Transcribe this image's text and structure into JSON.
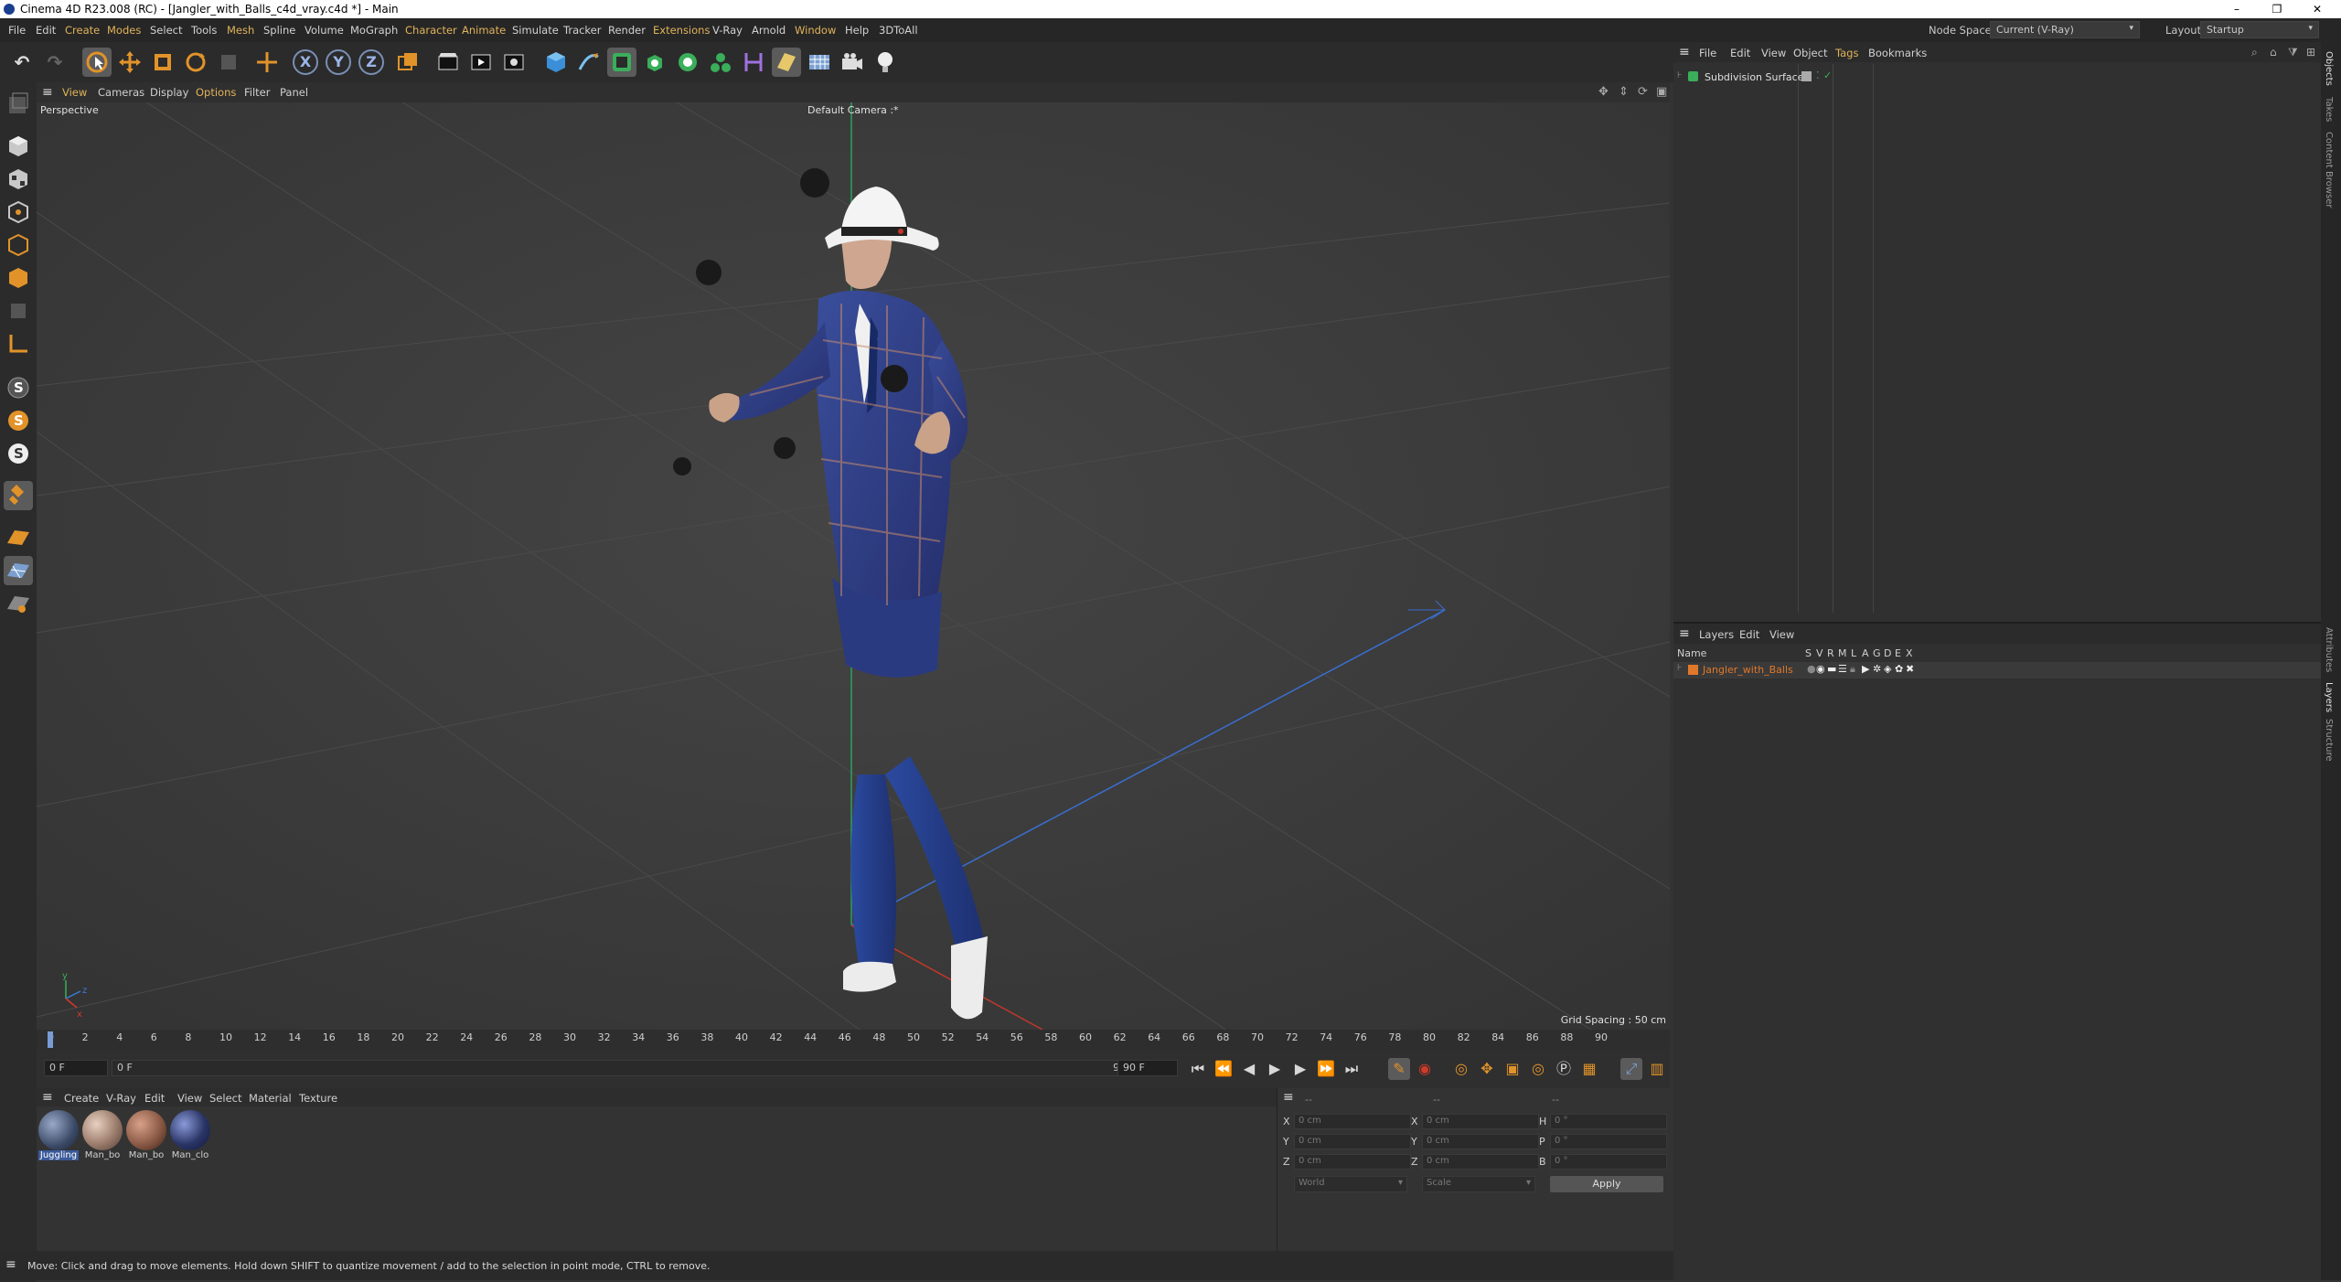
{
  "window": {
    "title": "Cinema 4D R23.008 (RC) - [Jangler_with_Balls_c4d_vray.c4d *] - Main",
    "minimize": "–",
    "restore": "❐",
    "close": "✕"
  },
  "menubar": {
    "items": [
      "File",
      "Edit",
      "Create",
      "Modes",
      "Select",
      "Tools",
      "Mesh",
      "Spline",
      "Volume",
      "MoGraph",
      "Character",
      "Animate",
      "Simulate",
      "Tracker",
      "Render",
      "Extensions",
      "V-Ray",
      "Arnold",
      "Window",
      "Help",
      "3DToAll"
    ],
    "node_space_label": "Node Space:",
    "node_space_value": "Current (V-Ray)",
    "layout_label": "Layout:",
    "layout_value": "Startup"
  },
  "toolbar": {
    "undo": "↶",
    "redo": "↷",
    "axis_x": "X",
    "axis_y": "Y",
    "axis_z": "Z"
  },
  "viewport": {
    "menu": [
      "View",
      "Cameras",
      "Display",
      "Options",
      "Filter",
      "Panel"
    ],
    "label": "Perspective",
    "camera": "Default Camera :*",
    "grid_spacing": "Grid Spacing : 50 cm",
    "axis_x": "x",
    "axis_y": "y",
    "axis_z": "z"
  },
  "timeline": {
    "ticks": [
      "0",
      "2",
      "4",
      "6",
      "8",
      "10",
      "12",
      "14",
      "16",
      "18",
      "20",
      "22",
      "24",
      "26",
      "28",
      "30",
      "32",
      "34",
      "36",
      "38",
      "40",
      "42",
      "44",
      "46",
      "48",
      "50",
      "52",
      "54",
      "56",
      "58",
      "60",
      "62",
      "64",
      "66",
      "68",
      "70",
      "72",
      "74",
      "76",
      "78",
      "80",
      "82",
      "84",
      "86",
      "88",
      "90"
    ],
    "current_frame_field": "0 F",
    "start_field": "0 F",
    "range_start": "0 F",
    "range_end": "90 F",
    "end_field": "90 F"
  },
  "materials": {
    "menu": [
      "Create",
      "V-Ray",
      "Edit",
      "View",
      "Select",
      "Material",
      "Texture"
    ],
    "items": [
      {
        "name": "Juggling",
        "color": "#3a4a66"
      },
      {
        "name": "Man_bo",
        "color": "#9b7c6c"
      },
      {
        "name": "Man_bo",
        "color": "#8b5a46"
      },
      {
        "name": "Man_clo",
        "color": "#2a3566"
      }
    ]
  },
  "coords": {
    "header_left": "--",
    "header_mid": "--",
    "header_right": "--",
    "rows": [
      {
        "l1": "X",
        "v1": "0 cm",
        "l2": "X",
        "v2": "0 cm",
        "l3": "H",
        "v3": "0 °"
      },
      {
        "l1": "Y",
        "v1": "0 cm",
        "l2": "Y",
        "v2": "0 cm",
        "l3": "P",
        "v3": "0 °"
      },
      {
        "l1": "Z",
        "v1": "0 cm",
        "l2": "Z",
        "v2": "0 cm",
        "l3": "B",
        "v3": "0 °"
      }
    ],
    "space_dropdown": "World",
    "mode_dropdown": "Scale",
    "apply": "Apply"
  },
  "status": {
    "text": "Move: Click and drag to move elements. Hold down SHIFT to quantize movement / add to the selection in point mode, CTRL to remove."
  },
  "objects": {
    "menu": [
      "File",
      "Edit",
      "View",
      "Object",
      "Tags",
      "Bookmarks"
    ],
    "rows": [
      {
        "name": "Subdivision Surface"
      }
    ]
  },
  "layers": {
    "menu": [
      "Layers",
      "Edit",
      "View"
    ],
    "header_name": "Name",
    "header_flags": [
      "S",
      "V",
      "R",
      "M",
      "L",
      "A",
      "G",
      "D",
      "E",
      "X"
    ],
    "rows": [
      {
        "name": "Jangler_with_Balls",
        "color": "#e0782a"
      }
    ]
  },
  "side_tabs": [
    "Objects",
    "Takes",
    "Content Browser",
    "Attributes",
    "Layers",
    "Structure"
  ],
  "colors": {
    "accent": "#e1b35a",
    "layer": "#e0782a",
    "axis_x": "#d03a2a",
    "axis_y": "#3aae5a",
    "axis_z": "#3a7ad8"
  }
}
